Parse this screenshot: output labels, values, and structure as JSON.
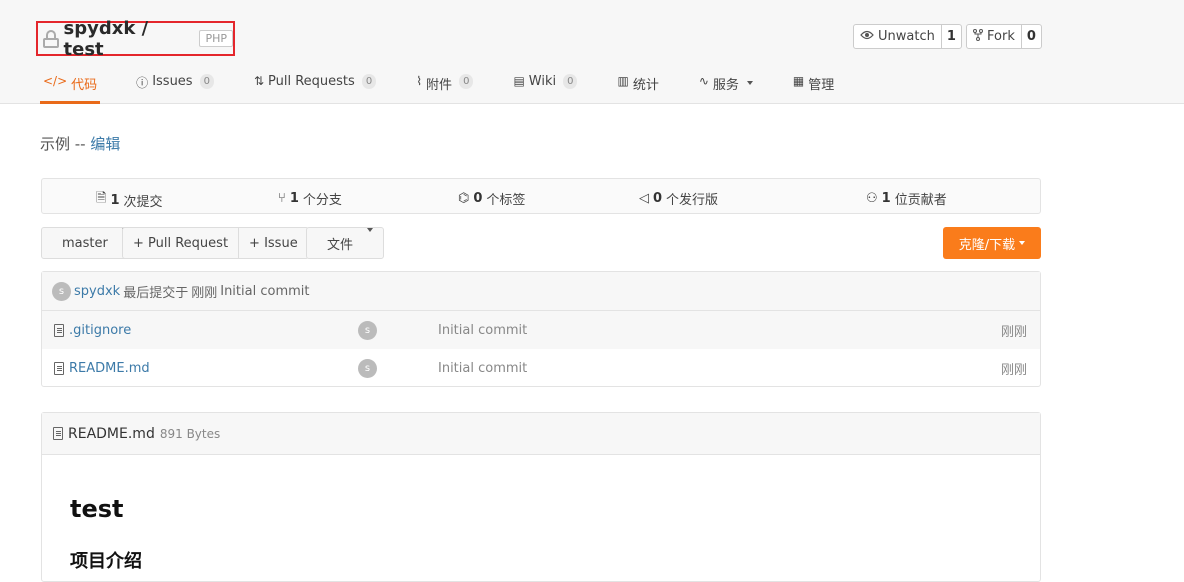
{
  "repo": {
    "owner_repo": "spydxk / test",
    "lang": "PHP"
  },
  "actions": {
    "watch_label": "Unwatch",
    "watch_count": "1",
    "fork_label": "Fork",
    "fork_count": "0"
  },
  "tabs": [
    {
      "icon": "code-icon",
      "label": "代码",
      "badge": ""
    },
    {
      "icon": "issues-icon",
      "label": "Issues",
      "badge": "0"
    },
    {
      "icon": "pull-request-icon",
      "label": "Pull Requests",
      "badge": "0"
    },
    {
      "icon": "attachment-icon",
      "label": "附件",
      "badge": "0"
    },
    {
      "icon": "wiki-icon",
      "label": "Wiki",
      "badge": "0"
    },
    {
      "icon": "chart-icon",
      "label": "统计",
      "badge": ""
    },
    {
      "icon": "pulse-icon",
      "label": "服务",
      "badge": ""
    },
    {
      "icon": "manage-icon",
      "label": "管理",
      "badge": ""
    }
  ],
  "description": {
    "text": "示例 -- ",
    "edit": "编辑"
  },
  "stats": {
    "commits_num": "1",
    "commits_label": "次提交",
    "branches_num": "1",
    "branches_label": "个分支",
    "tags_num": "0",
    "tags_label": "个标签",
    "releases_num": "0",
    "releases_label": "个发行版",
    "contributors_num": "1",
    "contributors_label": "位贡献者"
  },
  "toolbar": {
    "branch": "master",
    "new_pr": "+ Pull Request",
    "new_issue": "+ Issue",
    "file_menu": "文件",
    "clone": "克隆/下载"
  },
  "last_commit": {
    "avatar": "s",
    "author": "spydxk",
    "text": "最后提交于",
    "time": "刚刚",
    "message": "Initial commit"
  },
  "files": [
    {
      "name": ".gitignore",
      "avatar": "s",
      "message": "Initial commit",
      "time": "刚刚"
    },
    {
      "name": "README.md",
      "avatar": "s",
      "message": "Initial commit",
      "time": "刚刚"
    }
  ],
  "readme": {
    "filename": "README.md",
    "size": "891 Bytes",
    "h1": "test",
    "h3": "项目介绍"
  }
}
